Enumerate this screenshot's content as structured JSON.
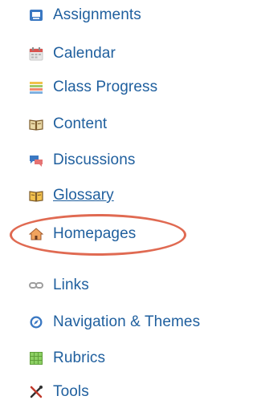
{
  "menu": {
    "items": [
      {
        "label": "Assignments",
        "icon": "assignments-icon"
      },
      {
        "label": "Calendar",
        "icon": "calendar-icon"
      },
      {
        "label": "Class Progress",
        "icon": "class-progress-icon"
      },
      {
        "label": "Content",
        "icon": "content-book-icon"
      },
      {
        "label": "Discussions",
        "icon": "discussions-icon"
      },
      {
        "label": "Glossary",
        "icon": "glossary-book-icon"
      },
      {
        "label": "Homepages",
        "icon": "homepages-house-icon",
        "highlighted": true
      },
      {
        "label": "Links",
        "icon": "links-chain-icon"
      },
      {
        "label": "Navigation & Themes",
        "icon": "navigation-compass-icon"
      },
      {
        "label": "Rubrics",
        "icon": "rubrics-grid-icon"
      },
      {
        "label": "Tools",
        "icon": "tools-icon"
      }
    ]
  },
  "colors": {
    "link": "#1f5f9e",
    "highlight": "#e06a52"
  }
}
